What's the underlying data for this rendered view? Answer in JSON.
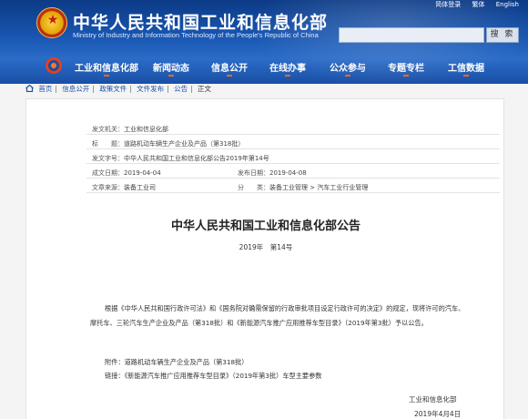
{
  "header": {
    "title": "中华人民共和国工业和信息化部",
    "subtitle": "Ministry of Industry and Information Technology of the People's Republic of China",
    "top_links": [
      "简体登录",
      "繁体",
      "English"
    ],
    "search_button": "搜 索",
    "search_placeholder": ""
  },
  "nav": {
    "items": [
      "工业和信息化部",
      "新闻动态",
      "信息公开",
      "在线办事",
      "公众参与",
      "专题专栏",
      "工信数据"
    ]
  },
  "breadcrumb": [
    "首页",
    "信息公开",
    "政策文件",
    "文件发布",
    "公告",
    "正文"
  ],
  "meta": {
    "issuer_label": "发文机关：",
    "issuer": "工业和信息化部",
    "title_label": "标　　题：",
    "title": "道路机动车辆生产企业及产品（第318批）",
    "doc_no_label": "发文字号：",
    "doc_no": "中华人民共和国工业和信息化部公告2019年第14号",
    "date_label": "成文日期：",
    "date": "2019-04-04",
    "publish_label": "发布日期：",
    "publish": "2019-04-08",
    "unit_label": "文章来源：",
    "unit": "装备工业司",
    "category_label": "分　　类：",
    "category": "装备工业管理 > 汽车工业行业管理"
  },
  "document": {
    "heading": "中华人民共和国工业和信息化部公告",
    "number": "2019年　第14号",
    "body": "根据《中华人民共和国行政许可法》和《国务院对确需保留的行政审批项目设定行政许可的决定》的规定，现将许可的汽车、摩托车、三轮汽车生产企业及产品（第318批）和《新能源汽车推广应用推荐车型目录》（2019年第3批）予以公告。",
    "attachment_1": "附件：道路机动车辆生产企业及产品（第318批）",
    "attachment_2": "链接：《新能源汽车推广应用推荐车型目录》（2019年第3批）车型主要参数",
    "signature_org": "工业和信息化部",
    "signature_date": "2019年4月4日"
  }
}
